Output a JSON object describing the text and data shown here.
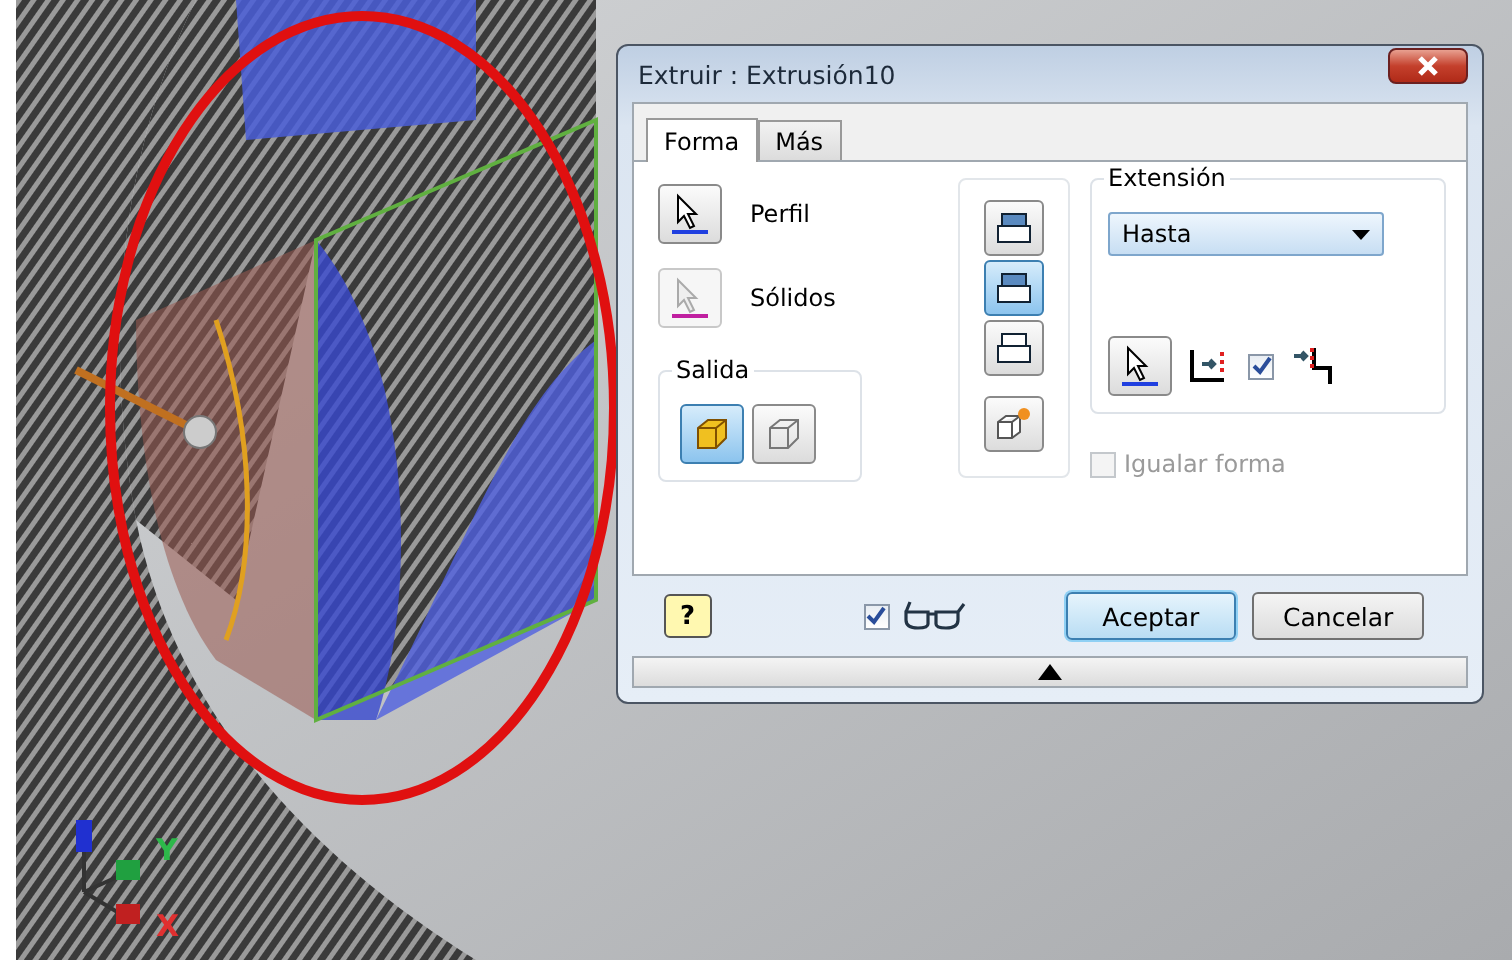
{
  "viewport": {
    "axis_labels": [
      {
        "text": "Y",
        "color": "#2db84a"
      },
      {
        "text": "X",
        "color": "#e03030"
      }
    ]
  },
  "dialog": {
    "title": "Extruir : Extrusión10",
    "tabs": [
      {
        "label": "Forma",
        "selected": true
      },
      {
        "label": "Más",
        "selected": false
      }
    ],
    "selectors": [
      {
        "label": "Perfil",
        "color": "#2040e0",
        "disabled": false
      },
      {
        "label": "Sólidos",
        "color": "#c020a0",
        "disabled": true
      }
    ],
    "output": {
      "title": "Salida",
      "options": [
        {
          "kind": "solid",
          "selected": true
        },
        {
          "kind": "surface",
          "selected": false
        }
      ]
    },
    "directions": [
      {
        "selected": false
      },
      {
        "selected": true
      },
      {
        "selected": false
      }
    ],
    "extent": {
      "title": "Extensión",
      "value": "Hasta",
      "extend_checked": true
    },
    "match_shape": {
      "label": "Igualar forma",
      "checked": false,
      "disabled": true
    },
    "help_label": "?",
    "preview_checked": true,
    "buttons": [
      {
        "label": "Aceptar",
        "default": true
      },
      {
        "label": "Cancelar",
        "default": false
      }
    ]
  }
}
